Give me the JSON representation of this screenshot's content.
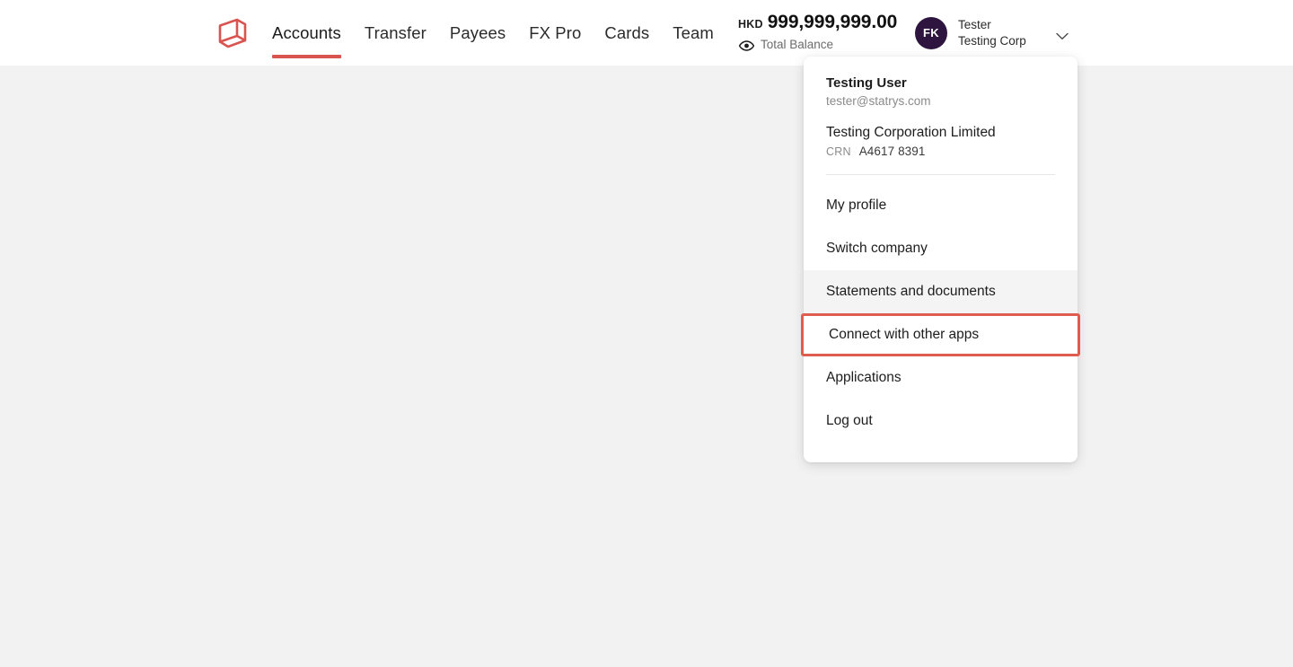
{
  "header": {
    "logo_icon": "statrys-logo-icon",
    "nav": [
      {
        "label": "Accounts",
        "active": true
      },
      {
        "label": "Transfer",
        "active": false
      },
      {
        "label": "Payees",
        "active": false
      },
      {
        "label": "FX Pro",
        "active": false
      },
      {
        "label": "Cards",
        "active": false
      },
      {
        "label": "Team",
        "active": false
      }
    ],
    "balance": {
      "currency": "HKD",
      "amount": "999,999,999.00",
      "label": "Total Balance",
      "visibility_icon": "eye-icon"
    },
    "account_button": {
      "avatar_initials": "FK",
      "name": "Tester",
      "company": "Testing Corp",
      "chevron_icon": "chevron-down-icon"
    }
  },
  "dropdown": {
    "user_name": "Testing User",
    "user_email": "tester@statrys.com",
    "company_name": "Testing Corporation Limited",
    "crn_label": "CRN",
    "crn_value": "A4617 8391",
    "items": [
      {
        "label": "My profile",
        "state": "default"
      },
      {
        "label": "Switch company",
        "state": "default"
      },
      {
        "label": "Statements and documents",
        "state": "hovered"
      },
      {
        "label": "Connect with other apps",
        "state": "highlighted"
      },
      {
        "label": "Applications",
        "state": "default"
      },
      {
        "label": "Log out",
        "state": "default"
      }
    ]
  },
  "colors": {
    "accent": "#d9534f",
    "highlight_border": "#e05c4e",
    "avatar_bg": "#2d1540",
    "page_bg": "#f2f2f2",
    "header_bg": "#ffffff"
  }
}
